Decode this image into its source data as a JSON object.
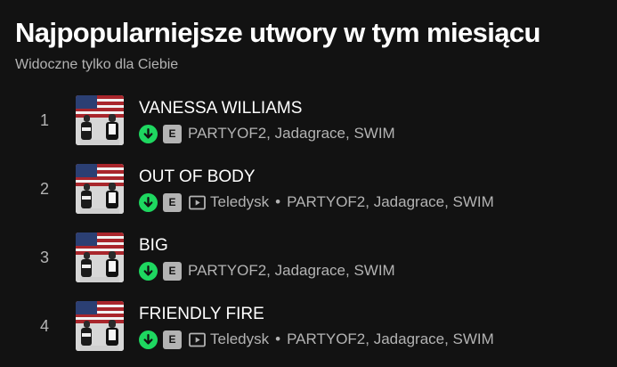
{
  "section": {
    "title": "Najpopularniejsze utwory w tym miesiącu",
    "subtitle": "Widoczne tylko dla Ciebie"
  },
  "colors": {
    "background": "#121212",
    "downloaded_accent": "#1ed760",
    "secondary_text": "#b3b3b3"
  },
  "icons": {
    "downloaded": "download-arrow-icon",
    "explicit": "explicit-badge",
    "video": "video-play-icon"
  },
  "tracks": [
    {
      "index": "1",
      "title": "VANESSA WILLIAMS",
      "explicit_label": "E",
      "video_label": "",
      "bullet": "",
      "artists": "PARTYOF2, Jadagrace, SWIM"
    },
    {
      "index": "2",
      "title": "OUT OF BODY",
      "explicit_label": "E",
      "video_label": "Teledysk",
      "bullet": "•",
      "artists": "PARTYOF2, Jadagrace, SWIM"
    },
    {
      "index": "3",
      "title": "BIG",
      "explicit_label": "E",
      "video_label": "",
      "bullet": "",
      "artists": "PARTYOF2, Jadagrace, SWIM"
    },
    {
      "index": "4",
      "title": "FRIENDLY FIRE",
      "explicit_label": "E",
      "video_label": "Teledysk",
      "bullet": "•",
      "artists": "PARTYOF2, Jadagrace, SWIM"
    }
  ]
}
